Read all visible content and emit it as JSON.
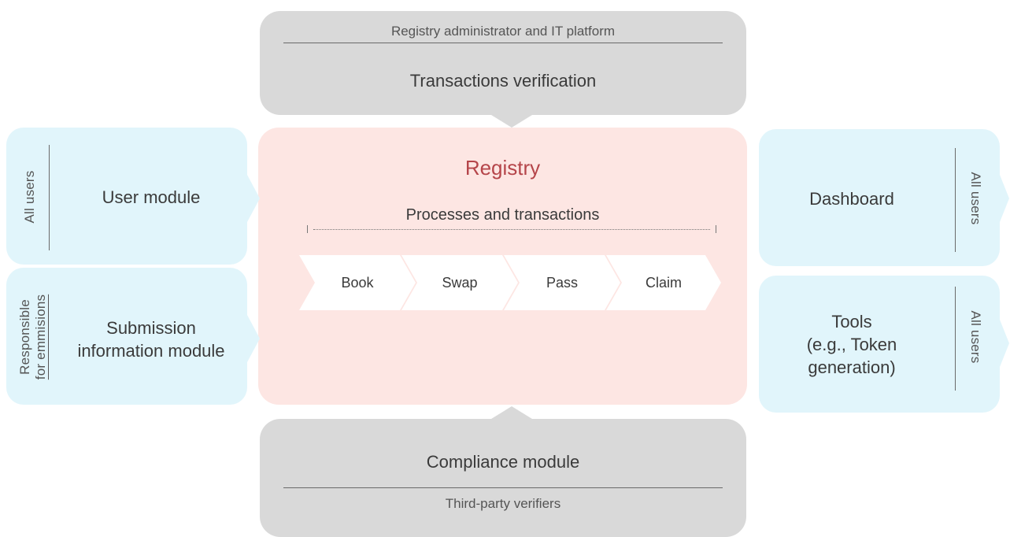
{
  "top": {
    "subtitle": "Registry administrator and IT platform",
    "title": "Transactions verification"
  },
  "registry": {
    "title": "Registry",
    "processes_label": "Processes and transactions",
    "steps": [
      "Book",
      "Swap",
      "Pass",
      "Claim"
    ]
  },
  "left": [
    {
      "side_label": "All users",
      "title_lines": [
        "User module"
      ]
    },
    {
      "side_label_lines": [
        "Responsible",
        "for emmisions"
      ],
      "title_lines": [
        "Submission",
        "information module"
      ]
    }
  ],
  "right": [
    {
      "side_label": "All users",
      "title_lines": [
        "Dashboard"
      ]
    },
    {
      "side_label": "All users",
      "title_lines": [
        "Tools",
        "(e.g., Token",
        "generation)"
      ]
    }
  ],
  "bottom": {
    "title": "Compliance module",
    "subtitle": "Third-party verifiers"
  },
  "colors": {
    "grey_box": "#d9d9d9",
    "blue_box": "#e1f5fb",
    "pink_box": "#fde6e3",
    "registry_title": "#b5454a",
    "step_fill": "#ffffff"
  }
}
